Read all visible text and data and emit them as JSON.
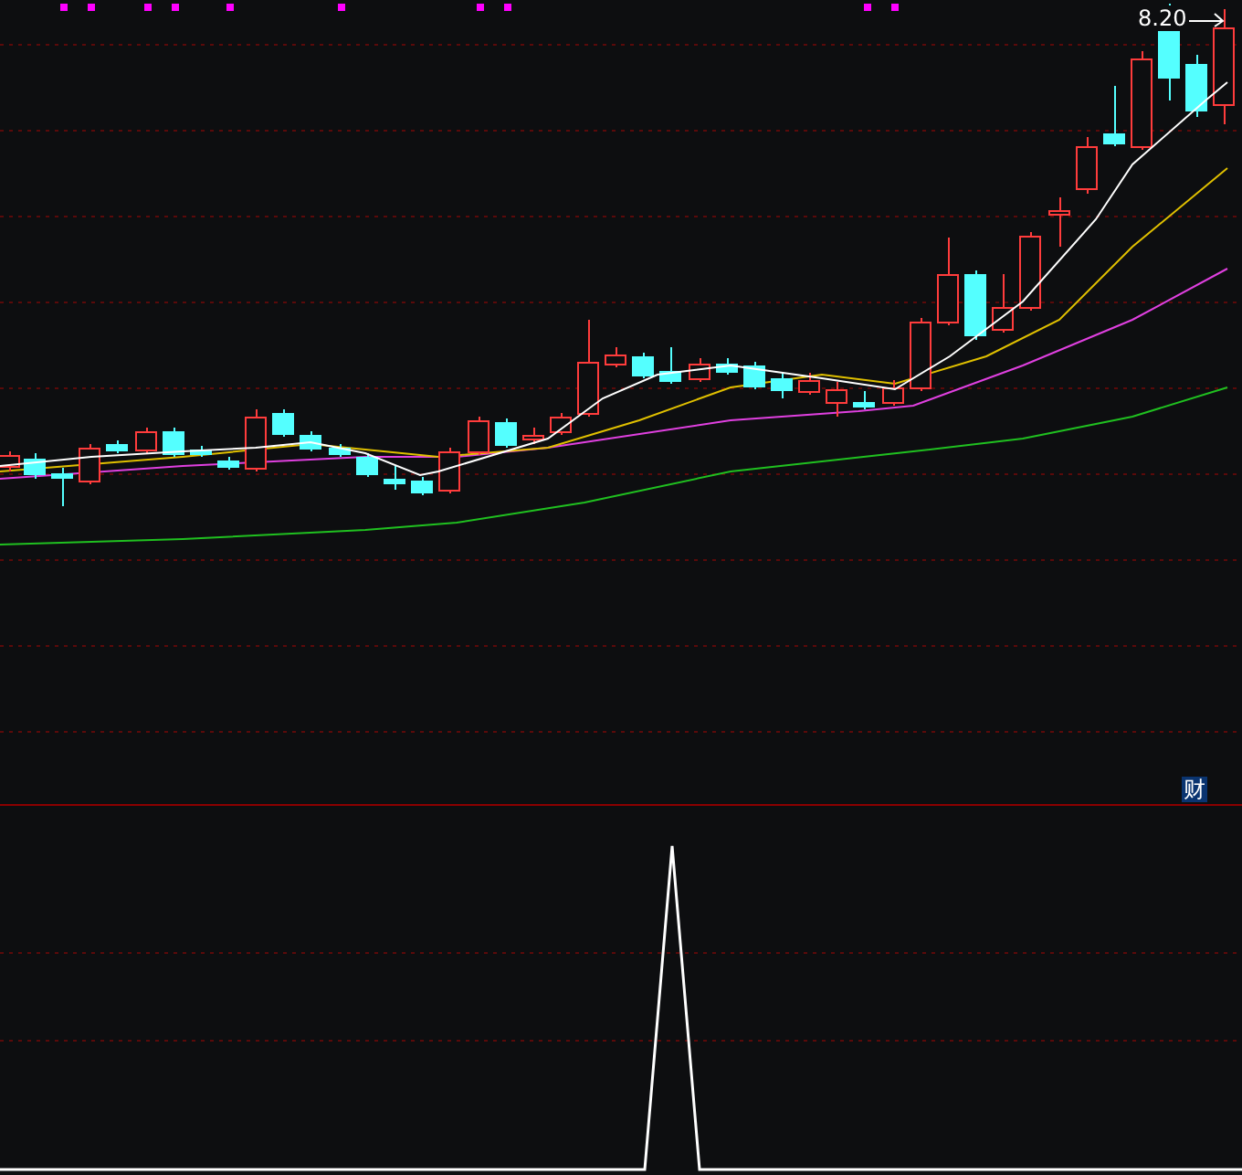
{
  "price_chart": {
    "high_label": "8.20"
  },
  "indicator_panel": {
    "badge": "财"
  }
}
